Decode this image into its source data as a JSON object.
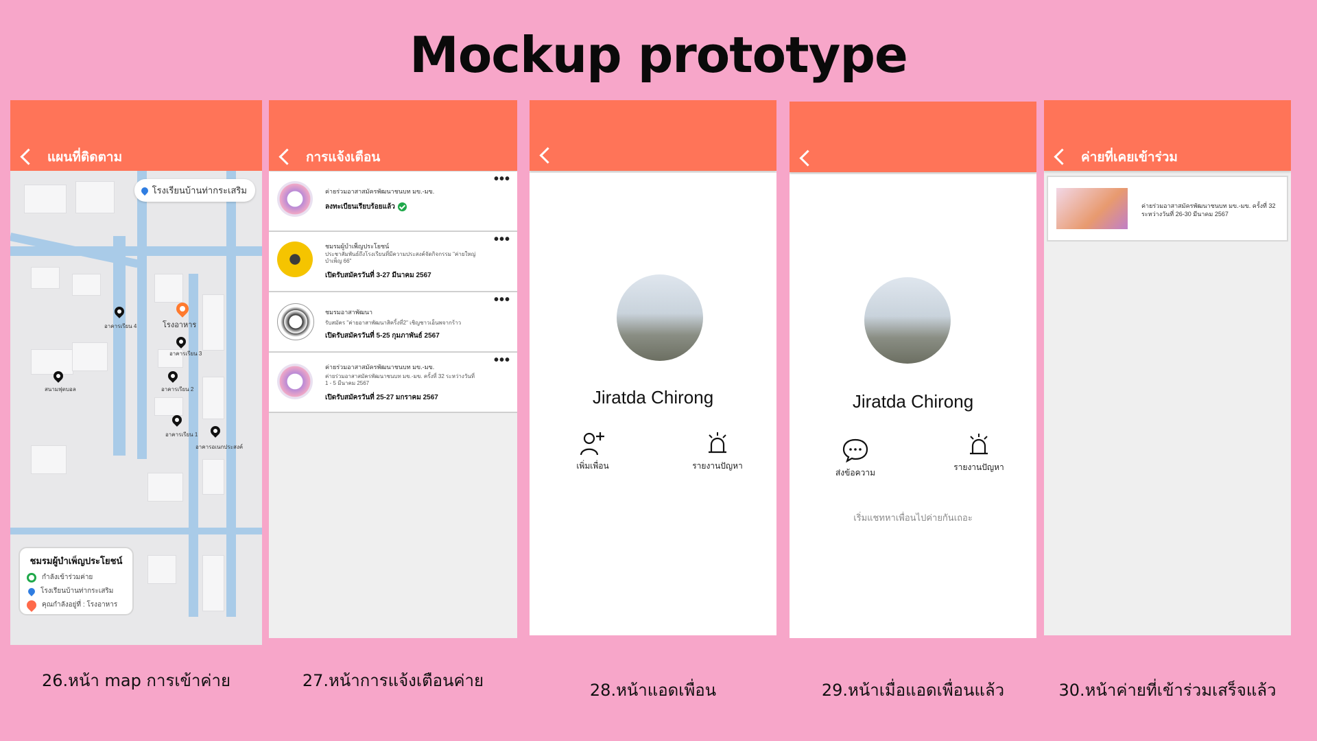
{
  "title": "Mockup prototype",
  "screens": {
    "map": {
      "bar_title": "แผนที่ติดตาม",
      "location_chip": "โรงเรียนบ้านท่ากระเสริม",
      "canteen_label": "โรงอาหาร",
      "building_labels": [
        "อาคารเรียน 4",
        "อาคารเรียน 3",
        "สนามฟุตบอล",
        "อาคารเรียน 2",
        "อาคารเรียน 1",
        "อาคารอเนกประสงค์"
      ],
      "legend": {
        "title": "ชมรมผู้บำเพ็ญประโยชน์",
        "items": [
          "กำลังเข้าร่วมค่าย",
          "โรงเรียนบ้านท่ากระเสริม",
          "คุณกำลังอยู่ที่ : โรงอาหาร"
        ]
      },
      "caption": "26.หน้า map การเข้าค่าย"
    },
    "notifications": {
      "bar_title": "การแจ้งเตือน",
      "items": [
        {
          "org": "ค่ายร่วมอาสาสมัครพัฒนาชนบท มข.-มข.",
          "detail": "",
          "status": "ลงทะเบียนเรียบร้อยแล้ว"
        },
        {
          "org": "ชมรมผู้บำเพ็ญประโยชน์",
          "detail": "ประชาสัมพันธ์ถึงโรงเรียนที่มีความประสงค์จัดกิจกรรม \"ค่ายใหญ่บำเพ็ญ 66\"",
          "status": "เปิดรับสมัครวันที่ 3-27 มีนาคม 2567"
        },
        {
          "org": "ชมรมอาสาพัฒนา",
          "detail": "รับสมัคร \"ค่ายอาสาพัฒนาสิคริ้งที่2\" เชิญชาวเอ็นพจากร้าว",
          "status": "เปิดรับสมัครวันที่ 5-25 กุมภาพันธ์ 2567"
        },
        {
          "org": "ค่ายร่วมอาสาสมัครพัฒนาชนบท มข.-มข.",
          "detail": "ค่ายร่วมอาสาสมัครพัฒนาชนบท มข.-มข. ครั้งที่ 32 ระหว่างวันที่ 1 - 5 มีนาคม 2567",
          "status": "เปิดรับสมัครวันที่ 25-27 มกราคม 2567"
        }
      ],
      "more_glyph": "•••",
      "caption": "27.หน้าการแจ้งเตือนค่าย"
    },
    "add_friend": {
      "name": "Jiratda Chirong",
      "actions": [
        "เพิ่มเพื่อน",
        "รายงานปัญหา"
      ],
      "caption": "28.หน้าแอดเพื่อน"
    },
    "friend_added": {
      "name": "Jiratda Chirong",
      "actions": [
        "ส่งข้อความ",
        "รายงานปัญหา"
      ],
      "hint": "เริ่มแชทหาเพื่อนไปค่ายกันเถอะ",
      "caption": "29.หน้าเมื่อแอดเพื่อนแล้ว"
    },
    "joined_camps": {
      "bar_title": "ค่ายที่เคยเข้าร่วม",
      "camp_line1": "ค่ายร่วมอาสาสมัครพัฒนาชนบท มข.-มข. ครั้งที่ 32",
      "camp_line2": "ระหว่างวันที่ 26-30 มีนาคม 2567",
      "caption": "30.หน้าค่ายที่เข้าร่วมเสร็จแล้ว"
    }
  },
  "colors": {
    "background": "#f7a6c9",
    "appbar": "#ff7458"
  }
}
